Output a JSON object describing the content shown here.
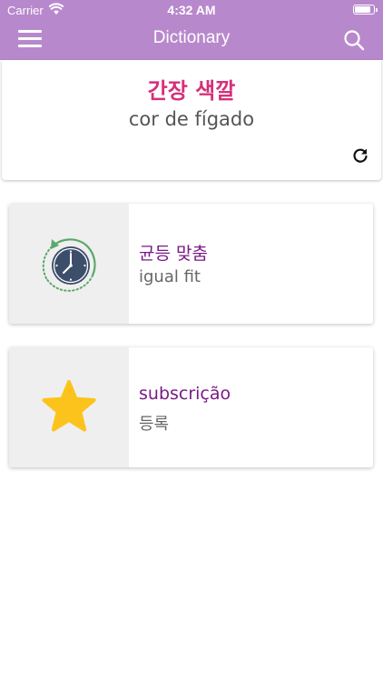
{
  "status_bar": {
    "carrier": "Carrier",
    "time": "4:32 AM"
  },
  "nav": {
    "title": "Dictionary",
    "menu_icon": "hamburger-menu-icon",
    "search_icon": "search-icon"
  },
  "word_of_day": {
    "word": "간장 색깔",
    "translation": "cor de fígado",
    "refresh_icon": "refresh-icon"
  },
  "items": [
    {
      "icon": "history-clock-icon",
      "title": "균등 맞춤",
      "subtitle": "igual fit"
    },
    {
      "icon": "star-icon",
      "title": "subscrição",
      "subtitle": "등록"
    }
  ],
  "colors": {
    "nav_background": "#b888cc",
    "word_color": "#d6307a",
    "item_title_color": "#7a1a86",
    "star_color": "#fcc31c",
    "clock_ring": "#5aa86b",
    "clock_face": "#3d4e6b"
  }
}
